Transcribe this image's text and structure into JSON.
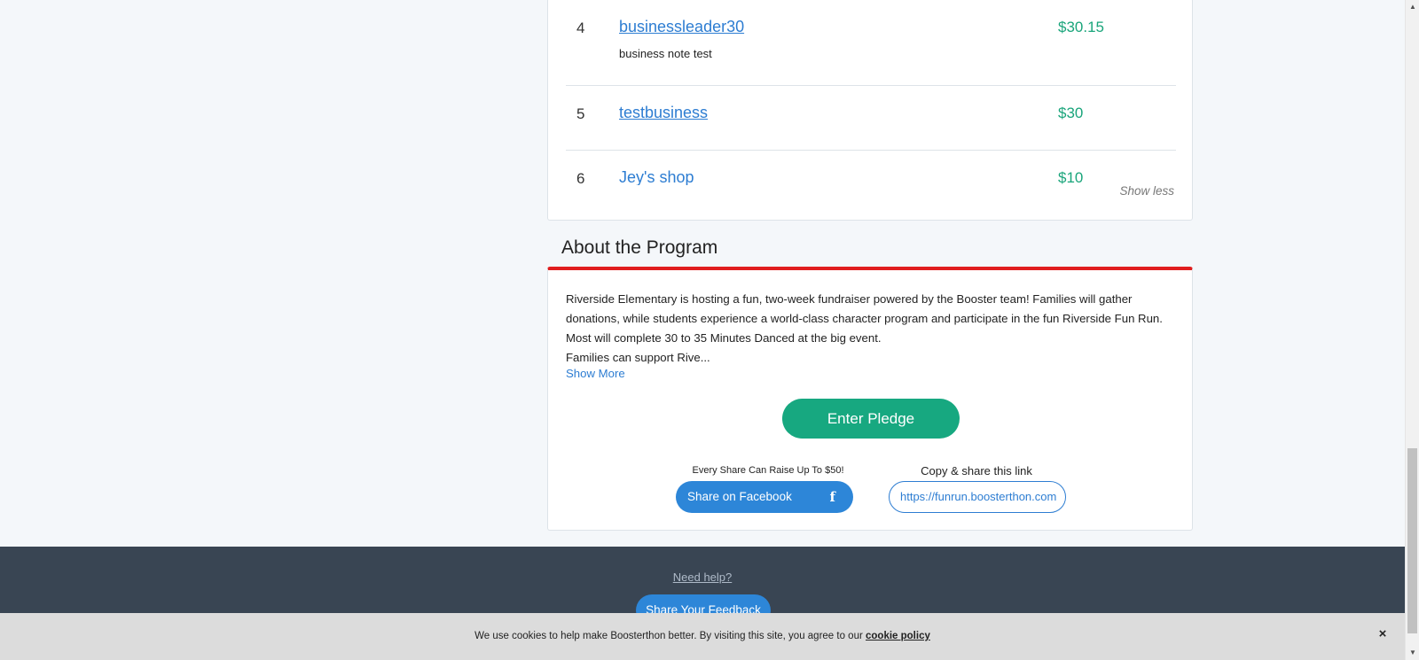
{
  "leaderboard": {
    "rows": [
      {
        "rank": "4",
        "name": "businessleader30",
        "note": "business note test",
        "amount": "$30.15"
      },
      {
        "rank": "5",
        "name": "testbusiness",
        "note": "",
        "amount": "$30"
      },
      {
        "rank": "6",
        "name": "Jey's shop",
        "note": "",
        "amount": "$10"
      }
    ],
    "show_less_label": "Show less"
  },
  "about": {
    "title": "About the Program",
    "paragraph1": "Riverside Elementary is hosting a fun, two-week fundraiser powered by the Booster team! Families will gather donations, while students experience a world-class character program and participate in the fun Riverside Fun Run. Most will complete 30 to 35 Minutes Danced at the big event.",
    "paragraph2": "Families can support Rive...",
    "show_more_label": "Show More",
    "pledge_label": "Enter Pledge",
    "share_caption": "Every Share Can Raise Up To $50!",
    "facebook_label": "Share on Facebook",
    "facebook_icon": "f",
    "copy_caption": "Copy & share this link",
    "share_link": "https://funrun.boosterthon.com"
  },
  "footer": {
    "need_help_label": "Need help?",
    "feedback_label": "Share Your Feedback"
  },
  "cookie": {
    "text": "We use cookies to help make Boosterthon better. By visiting this site, you agree to our ",
    "link_label": "cookie policy",
    "close_icon": "×"
  },
  "scrollbar": {
    "up_arrow": "▲",
    "down_arrow": "▼"
  },
  "colors": {
    "accent_green": "#17a880",
    "link_blue": "#2d7dd2",
    "section_red": "#e01e1e",
    "footer_bg": "#394553"
  }
}
